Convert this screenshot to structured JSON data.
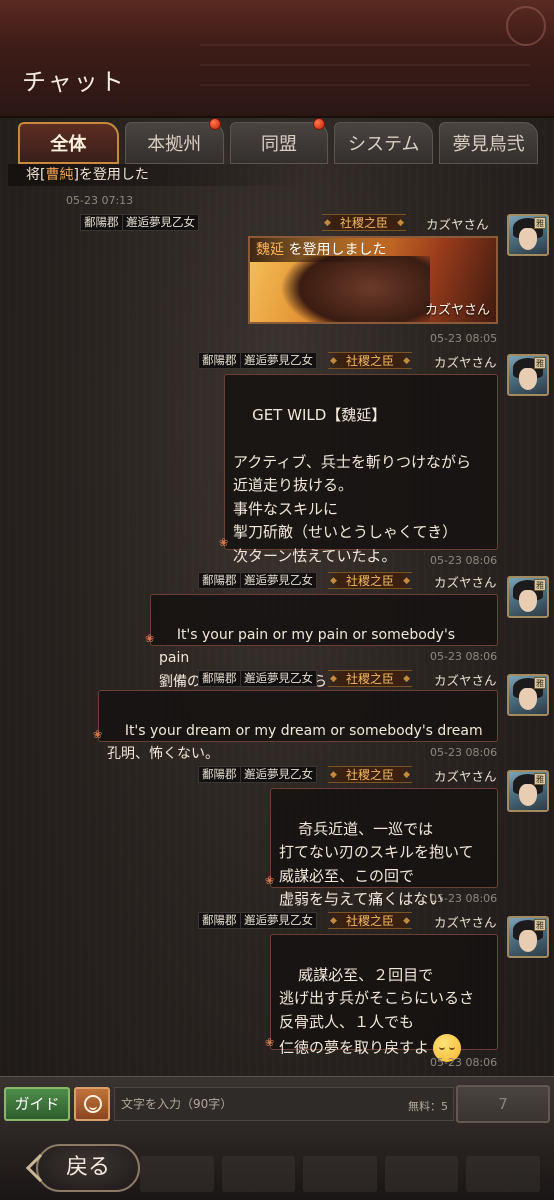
{
  "header": {
    "title": "チャット"
  },
  "tabs": [
    {
      "label": "全体",
      "active": true,
      "badge": false
    },
    {
      "label": "本拠州",
      "active": false,
      "badge": true
    },
    {
      "label": "同盟",
      "active": false,
      "badge": true
    },
    {
      "label": "システム",
      "active": false,
      "badge": false
    },
    {
      "label": "夢見鳥弐",
      "active": false,
      "badge": false
    }
  ],
  "system_line": {
    "prefix": "将[",
    "name": "曹純",
    "suffix": "]を登用した"
  },
  "top_timestamp": "05-23 07:13",
  "first_tags": [
    "鄱陽郡",
    "邂逅夢見乙女"
  ],
  "messages": [
    {
      "tags": [
        "鄱陽郡",
        "邂逅夢見乙女"
      ],
      "rank": "社稷之臣",
      "user": "カズヤさん",
      "card": {
        "name": "魏延",
        "caption_suffix": " を登用しました",
        "signature": "カズヤさん"
      },
      "time": "05-23 08:05"
    },
    {
      "tags": [
        "鄱陽郡",
        "邂逅夢見乙女"
      ],
      "rank": "社稷之臣",
      "user": "カズヤさん",
      "text": "GET WILD【魏延】\n\nアクティブ、兵士を斬りつけながら\n近道走り抜ける。\n事件なスキルに\n掣刀斫敵（せいとうしゃくてき）\n次ターン怯えていたよ。",
      "time": "05-23 08:06"
    },
    {
      "tags": [
        "鄱陽郡",
        "邂逅夢見乙女"
      ],
      "rank": "社稷之臣",
      "user": "カズヤさん",
      "text": "It's your pain or my pain or somebody's pain\n劉備の為に生きられるなら",
      "time": "05-23 08:06"
    },
    {
      "tags": [
        "鄱陽郡",
        "邂逅夢見乙女"
      ],
      "rank": "社稷之臣",
      "user": "カズヤさん",
      "text": "It's your dream or my dream or somebody's dream\n孔明、怖くない。",
      "time": "05-23 08:06"
    },
    {
      "tags": [
        "鄱陽郡",
        "邂逅夢見乙女"
      ],
      "rank": "社稷之臣",
      "user": "カズヤさん",
      "text": "奇兵近道、一巡では\n打てない刃のスキルを抱いて\n威謀必至、この回で\n虚弱を与えて痛くはない",
      "time": "05-23 08:06"
    },
    {
      "tags": [
        "鄱陽郡",
        "邂逅夢見乙女"
      ],
      "rank": "社稷之臣",
      "user": "カズヤさん",
      "text": "威謀必至、２回目で\n逃げ出す兵がそこらにいるさ\n反骨武人、１人でも\n",
      "text_last": "仁徳の夢を取り戻すよ",
      "time": "05-23 08:06"
    }
  ],
  "avatar_badge": "雅",
  "input": {
    "guide_label": "ガイド",
    "placeholder": "文字を入力（90字）",
    "free_label": "無料：5",
    "send_label": "7"
  },
  "bottom": {
    "back_label": "戻る"
  },
  "colors": {
    "accent": "#c58a3c",
    "rank_text": "#f2b860",
    "bubble_border": "#6b3f36"
  }
}
